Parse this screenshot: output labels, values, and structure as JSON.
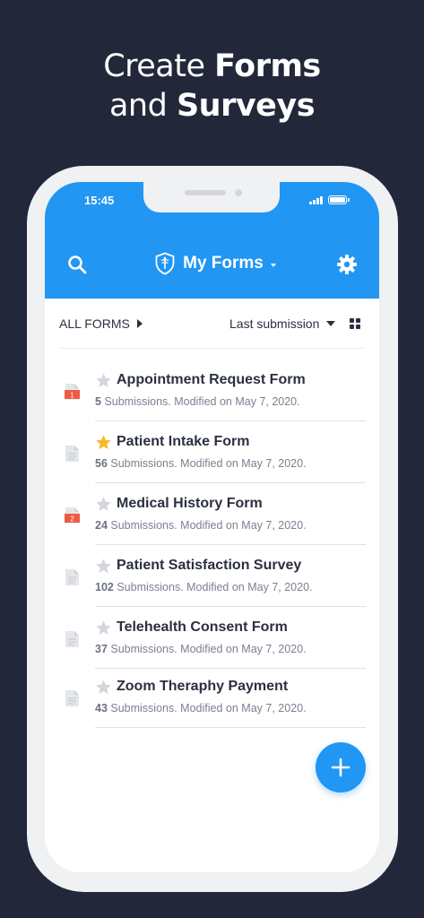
{
  "headline": {
    "line1_regular": "Create",
    "line1_bold": "Forms",
    "line2_regular": "and",
    "line2_bold": "Surveys"
  },
  "status_bar": {
    "time": "15:45"
  },
  "app_bar": {
    "title": "My Forms",
    "brand_color": "#2196f3",
    "icons": {
      "search": "search-icon",
      "settings": "gear-icon",
      "logo": "shield-logo-icon"
    }
  },
  "filter_bar": {
    "scope_label": "ALL FORMS",
    "sort_label": "Last submission",
    "view_toggle": "grid-view-icon"
  },
  "forms": [
    {
      "title": "Appointment Request Form",
      "count": "5",
      "meta": " Submissions. Modified on May 7, 2020.",
      "starred": false,
      "badge": "1"
    },
    {
      "title": "Patient Intake Form",
      "count": "56",
      "meta": " Submissions. Modified on May 7, 2020.",
      "starred": true,
      "badge": ""
    },
    {
      "title": "Medical History Form",
      "count": "24",
      "meta": " Submissions. Modified on May 7, 2020.",
      "starred": false,
      "badge": "2"
    },
    {
      "title": "Patient Satisfaction Survey",
      "count": "102",
      "meta": " Submissions. Modified on May 7, 2020.",
      "starred": false,
      "badge": ""
    },
    {
      "title": "Telehealth Consent Form",
      "count": "37",
      "meta": " Submissions. Modified on May 7, 2020.",
      "starred": false,
      "badge": ""
    },
    {
      "title": "Zoom Theraphy Payment",
      "count": "43",
      "meta": " Submissions. Modified on May 7, 2020.",
      "starred": false,
      "badge": ""
    }
  ],
  "fab": {
    "icon": "plus-icon"
  },
  "colors": {
    "background": "#22283a",
    "star_active": "#f7b928",
    "star_inactive": "#d3d7dd",
    "badge": "#ef5a45"
  }
}
